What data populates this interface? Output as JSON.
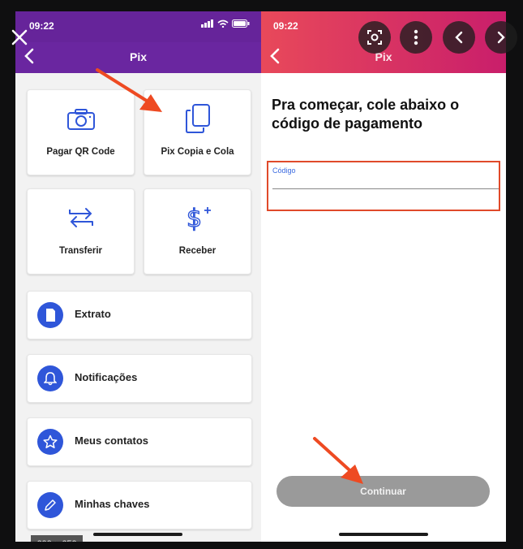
{
  "overlay": {
    "dimensions": "600 × 650"
  },
  "left": {
    "status": {
      "time": "09:22"
    },
    "nav": {
      "title": "Pix"
    },
    "tiles": [
      {
        "label": "Pagar QR Code",
        "icon": "camera-icon"
      },
      {
        "label": "Pix Copia e Cola",
        "icon": "copy-icon"
      },
      {
        "label": "Transferir",
        "icon": "transfer-icon"
      },
      {
        "label": "Receber",
        "icon": "dollar-plus-icon"
      }
    ],
    "rows": [
      {
        "label": "Extrato",
        "icon": "document-icon"
      },
      {
        "label": "Notificações",
        "icon": "bell-icon"
      },
      {
        "label": "Meus contatos",
        "icon": "star-icon"
      },
      {
        "label": "Minhas chaves",
        "icon": "pencil-icon"
      }
    ]
  },
  "right": {
    "status": {
      "time": "09:22"
    },
    "nav": {
      "title": "Pix"
    },
    "heading": "Pra começar, cole abaixo o código de pagamento",
    "code_field": {
      "label": "Código",
      "value": ""
    },
    "continue_label": "Continuar"
  },
  "colors": {
    "left_header": "#6a26a0",
    "right_header_start": "#e8495a",
    "right_header_end": "#c91e6b",
    "accent_blue": "#2f56d9",
    "annotation_red": "#e04a2a",
    "arrow_orange": "#ee4a22"
  }
}
